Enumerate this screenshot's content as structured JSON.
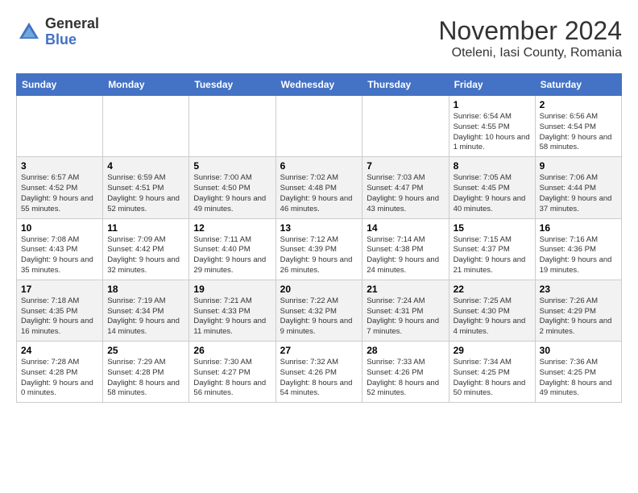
{
  "app": {
    "name_general": "General",
    "name_blue": "Blue"
  },
  "title": {
    "month_year": "November 2024",
    "location": "Oteleni, Iasi County, Romania"
  },
  "calendar": {
    "headers": [
      "Sunday",
      "Monday",
      "Tuesday",
      "Wednesday",
      "Thursday",
      "Friday",
      "Saturday"
    ],
    "rows": [
      [
        {
          "day": "",
          "info": ""
        },
        {
          "day": "",
          "info": ""
        },
        {
          "day": "",
          "info": ""
        },
        {
          "day": "",
          "info": ""
        },
        {
          "day": "",
          "info": ""
        },
        {
          "day": "1",
          "info": "Sunrise: 6:54 AM\nSunset: 4:55 PM\nDaylight: 10 hours and 1 minute."
        },
        {
          "day": "2",
          "info": "Sunrise: 6:56 AM\nSunset: 4:54 PM\nDaylight: 9 hours and 58 minutes."
        }
      ],
      [
        {
          "day": "3",
          "info": "Sunrise: 6:57 AM\nSunset: 4:52 PM\nDaylight: 9 hours and 55 minutes."
        },
        {
          "day": "4",
          "info": "Sunrise: 6:59 AM\nSunset: 4:51 PM\nDaylight: 9 hours and 52 minutes."
        },
        {
          "day": "5",
          "info": "Sunrise: 7:00 AM\nSunset: 4:50 PM\nDaylight: 9 hours and 49 minutes."
        },
        {
          "day": "6",
          "info": "Sunrise: 7:02 AM\nSunset: 4:48 PM\nDaylight: 9 hours and 46 minutes."
        },
        {
          "day": "7",
          "info": "Sunrise: 7:03 AM\nSunset: 4:47 PM\nDaylight: 9 hours and 43 minutes."
        },
        {
          "day": "8",
          "info": "Sunrise: 7:05 AM\nSunset: 4:45 PM\nDaylight: 9 hours and 40 minutes."
        },
        {
          "day": "9",
          "info": "Sunrise: 7:06 AM\nSunset: 4:44 PM\nDaylight: 9 hours and 37 minutes."
        }
      ],
      [
        {
          "day": "10",
          "info": "Sunrise: 7:08 AM\nSunset: 4:43 PM\nDaylight: 9 hours and 35 minutes."
        },
        {
          "day": "11",
          "info": "Sunrise: 7:09 AM\nSunset: 4:42 PM\nDaylight: 9 hours and 32 minutes."
        },
        {
          "day": "12",
          "info": "Sunrise: 7:11 AM\nSunset: 4:40 PM\nDaylight: 9 hours and 29 minutes."
        },
        {
          "day": "13",
          "info": "Sunrise: 7:12 AM\nSunset: 4:39 PM\nDaylight: 9 hours and 26 minutes."
        },
        {
          "day": "14",
          "info": "Sunrise: 7:14 AM\nSunset: 4:38 PM\nDaylight: 9 hours and 24 minutes."
        },
        {
          "day": "15",
          "info": "Sunrise: 7:15 AM\nSunset: 4:37 PM\nDaylight: 9 hours and 21 minutes."
        },
        {
          "day": "16",
          "info": "Sunrise: 7:16 AM\nSunset: 4:36 PM\nDaylight: 9 hours and 19 minutes."
        }
      ],
      [
        {
          "day": "17",
          "info": "Sunrise: 7:18 AM\nSunset: 4:35 PM\nDaylight: 9 hours and 16 minutes."
        },
        {
          "day": "18",
          "info": "Sunrise: 7:19 AM\nSunset: 4:34 PM\nDaylight: 9 hours and 14 minutes."
        },
        {
          "day": "19",
          "info": "Sunrise: 7:21 AM\nSunset: 4:33 PM\nDaylight: 9 hours and 11 minutes."
        },
        {
          "day": "20",
          "info": "Sunrise: 7:22 AM\nSunset: 4:32 PM\nDaylight: 9 hours and 9 minutes."
        },
        {
          "day": "21",
          "info": "Sunrise: 7:24 AM\nSunset: 4:31 PM\nDaylight: 9 hours and 7 minutes."
        },
        {
          "day": "22",
          "info": "Sunrise: 7:25 AM\nSunset: 4:30 PM\nDaylight: 9 hours and 4 minutes."
        },
        {
          "day": "23",
          "info": "Sunrise: 7:26 AM\nSunset: 4:29 PM\nDaylight: 9 hours and 2 minutes."
        }
      ],
      [
        {
          "day": "24",
          "info": "Sunrise: 7:28 AM\nSunset: 4:28 PM\nDaylight: 9 hours and 0 minutes."
        },
        {
          "day": "25",
          "info": "Sunrise: 7:29 AM\nSunset: 4:28 PM\nDaylight: 8 hours and 58 minutes."
        },
        {
          "day": "26",
          "info": "Sunrise: 7:30 AM\nSunset: 4:27 PM\nDaylight: 8 hours and 56 minutes."
        },
        {
          "day": "27",
          "info": "Sunrise: 7:32 AM\nSunset: 4:26 PM\nDaylight: 8 hours and 54 minutes."
        },
        {
          "day": "28",
          "info": "Sunrise: 7:33 AM\nSunset: 4:26 PM\nDaylight: 8 hours and 52 minutes."
        },
        {
          "day": "29",
          "info": "Sunrise: 7:34 AM\nSunset: 4:25 PM\nDaylight: 8 hours and 50 minutes."
        },
        {
          "day": "30",
          "info": "Sunrise: 7:36 AM\nSunset: 4:25 PM\nDaylight: 8 hours and 49 minutes."
        }
      ]
    ]
  }
}
